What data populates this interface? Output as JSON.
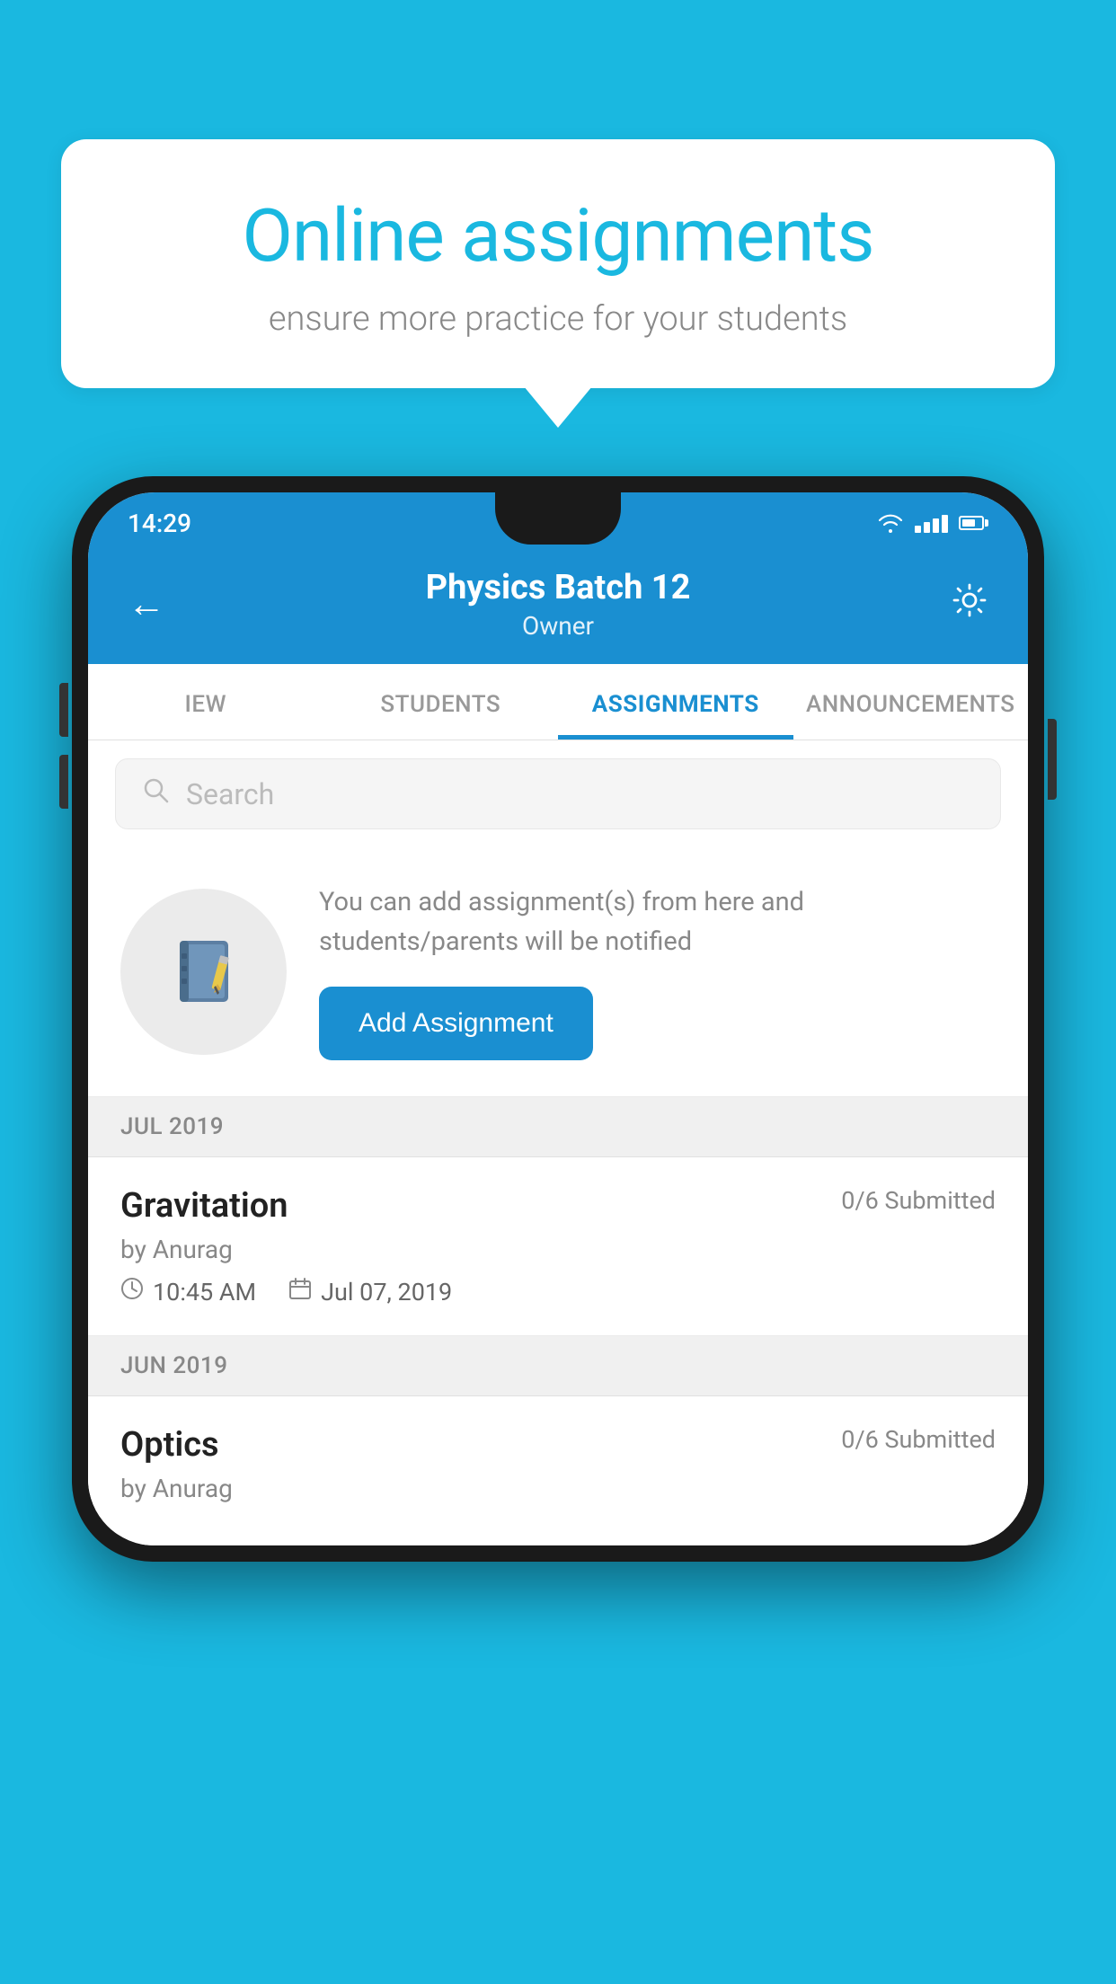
{
  "background_color": "#1ab8e0",
  "speech_bubble": {
    "title": "Online assignments",
    "subtitle": "ensure more practice for your students"
  },
  "phone": {
    "status_bar": {
      "time": "14:29"
    },
    "header": {
      "title": "Physics Batch 12",
      "subtitle": "Owner",
      "back_label": "←",
      "settings_label": "⚙"
    },
    "tabs": [
      {
        "label": "IEW",
        "active": false
      },
      {
        "label": "STUDENTS",
        "active": false
      },
      {
        "label": "ASSIGNMENTS",
        "active": true
      },
      {
        "label": "ANNOUNCEMENTS",
        "active": false
      }
    ],
    "search": {
      "placeholder": "Search"
    },
    "promo": {
      "text": "You can add assignment(s) from here and students/parents will be notified",
      "button_label": "Add Assignment"
    },
    "sections": [
      {
        "header": "JUL 2019",
        "assignments": [
          {
            "title": "Gravitation",
            "status": "0/6 Submitted",
            "author": "by Anurag",
            "time": "10:45 AM",
            "date": "Jul 07, 2019"
          }
        ]
      },
      {
        "header": "JUN 2019",
        "assignments": [
          {
            "title": "Optics",
            "status": "0/6 Submitted",
            "author": "by Anurag",
            "time": "",
            "date": ""
          }
        ]
      }
    ]
  }
}
